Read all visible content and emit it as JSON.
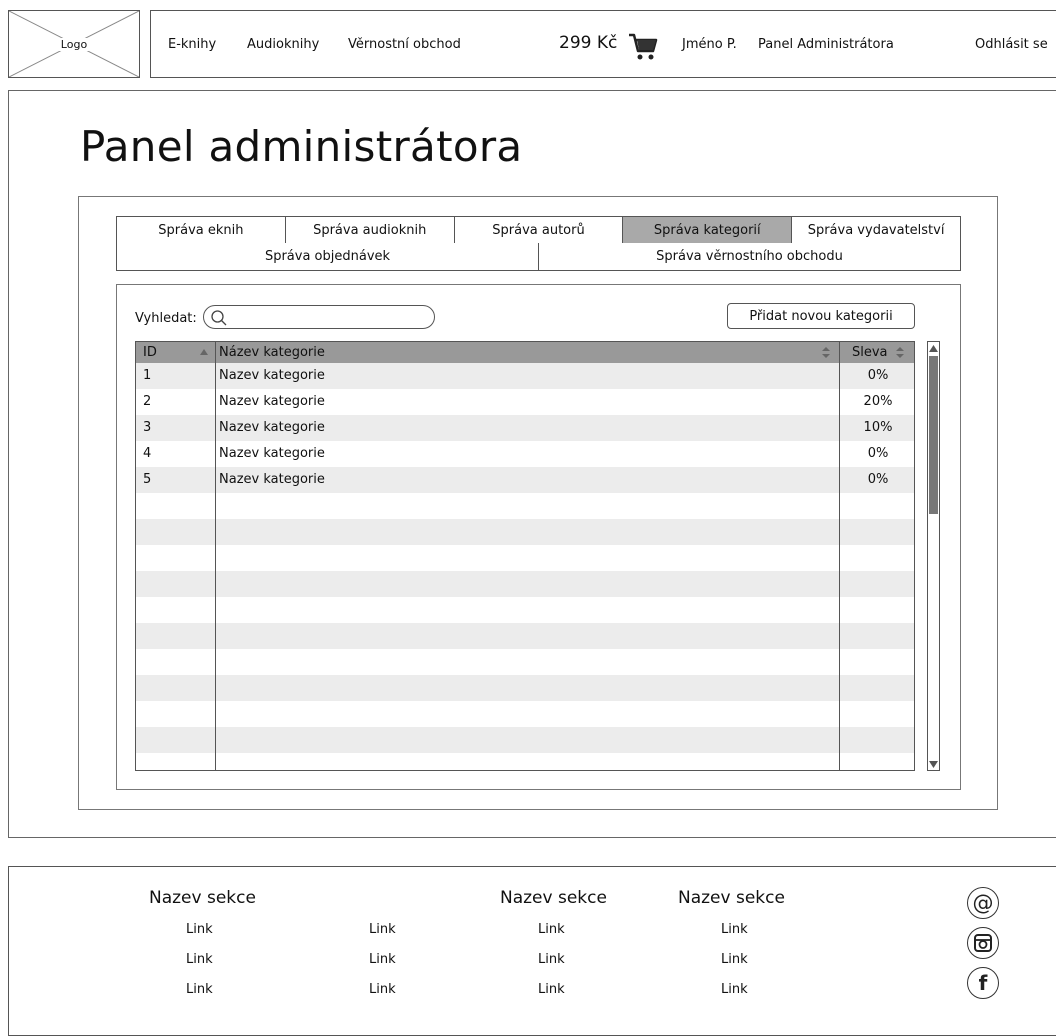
{
  "header": {
    "logo_label": "Logo",
    "nav": [
      "E-knihy",
      "Audioknihy",
      "Věrnostní obchod"
    ],
    "price": "299 Kč",
    "cart_icon": "cart-icon",
    "user_name": "Jméno P.",
    "admin_link": "Panel Administrátora",
    "logout": "Odhlásit se"
  },
  "main": {
    "title": "Panel administrátora",
    "tabs_row1": [
      {
        "label": "Správa eknih",
        "active": false
      },
      {
        "label": "Správa audioknih",
        "active": false
      },
      {
        "label": "Správa autorů",
        "active": false
      },
      {
        "label": "Správa kategorií",
        "active": true
      },
      {
        "label": "Správa vydavatelství",
        "active": false
      }
    ],
    "tabs_row2": [
      {
        "label": "Správa objednávek",
        "active": false
      },
      {
        "label": "Správa věrnostního obchodu",
        "active": false
      }
    ],
    "search": {
      "label": "Vyhledat:",
      "value": "",
      "placeholder": "",
      "icon": "search-icon"
    },
    "add_button": "Přidat novou kategorii",
    "table": {
      "columns": [
        "ID",
        "Název kategorie",
        "Sleva"
      ],
      "rows": [
        {
          "id": "1",
          "name": "Nazev kategorie",
          "discount": "0%"
        },
        {
          "id": "2",
          "name": "Nazev kategorie",
          "discount": "20%"
        },
        {
          "id": "3",
          "name": "Nazev kategorie",
          "discount": "10%"
        },
        {
          "id": "4",
          "name": "Nazev kategorie",
          "discount": "0%"
        },
        {
          "id": "5",
          "name": "Nazev kategorie",
          "discount": "0%"
        }
      ]
    }
  },
  "footer": {
    "headings": [
      "Nazev sekce",
      "Nazev sekce",
      "Nazev sekce"
    ],
    "columns": [
      [
        "Link",
        "Link",
        "Link"
      ],
      [
        "Link",
        "Link",
        "Link"
      ],
      [
        "Link",
        "Link",
        "Link"
      ],
      [
        "Link",
        "Link",
        "Link"
      ]
    ],
    "social_icons": [
      "email-icon",
      "instagram-icon",
      "facebook-icon"
    ]
  },
  "colors": {
    "active_tab": "#a9a9a9",
    "table_header": "#999999",
    "row_stripe": "#ececec",
    "border": "#555555"
  }
}
